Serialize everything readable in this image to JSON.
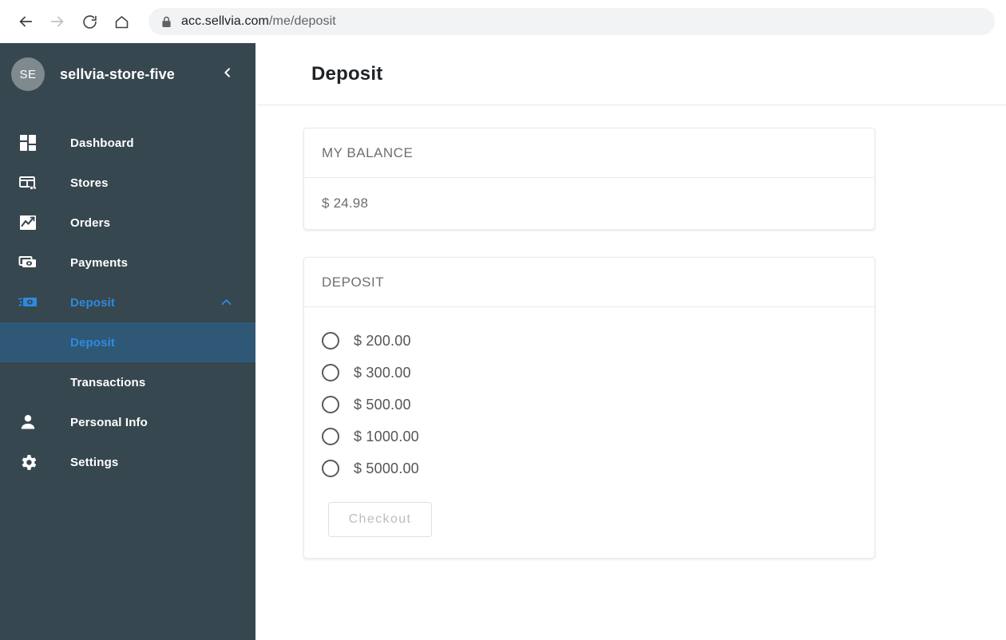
{
  "browser": {
    "back_icon": "back-arrow-icon",
    "forward_icon": "forward-arrow-icon",
    "reload_icon": "reload-icon",
    "home_icon": "home-icon",
    "lock_icon": "lock-icon",
    "url_host": "acc.sellvia.com",
    "url_path": "/me/deposit"
  },
  "sidebar": {
    "avatar_initials": "SE",
    "store_name": "sellvia-store-five",
    "collapse_icon": "chevron-left-icon",
    "items": [
      {
        "label": "Dashboard",
        "icon": "dashboard-grid-icon",
        "active": false
      },
      {
        "label": "Stores",
        "icon": "store-key-icon",
        "active": false
      },
      {
        "label": "Orders",
        "icon": "chart-line-icon",
        "active": false
      },
      {
        "label": "Payments",
        "icon": "banknotes-icon",
        "active": false
      },
      {
        "label": "Deposit",
        "icon": "deposit-banknote-icon",
        "active": true,
        "expand_icon": "chevron-up-icon"
      }
    ],
    "sub_items": [
      {
        "label": "Deposit",
        "active": true
      },
      {
        "label": "Transactions",
        "active": false
      }
    ],
    "bottom_items": [
      {
        "label": "Personal Info",
        "icon": "person-icon"
      },
      {
        "label": "Settings",
        "icon": "gear-icon"
      }
    ],
    "colors": {
      "background": "#37474f",
      "active_row": "#2f5876",
      "accent": "#2e8ae0"
    }
  },
  "page": {
    "title": "Deposit"
  },
  "balance_card": {
    "heading": "MY BALANCE",
    "value": "$ 24.98"
  },
  "deposit_card": {
    "heading": "DEPOSIT",
    "options": [
      {
        "label": "$ 200.00",
        "selected": false
      },
      {
        "label": "$ 300.00",
        "selected": false
      },
      {
        "label": "$ 500.00",
        "selected": false
      },
      {
        "label": "$ 1000.00",
        "selected": false
      },
      {
        "label": "$ 5000.00",
        "selected": false
      }
    ],
    "checkout_label": "Checkout",
    "checkout_disabled": true
  }
}
